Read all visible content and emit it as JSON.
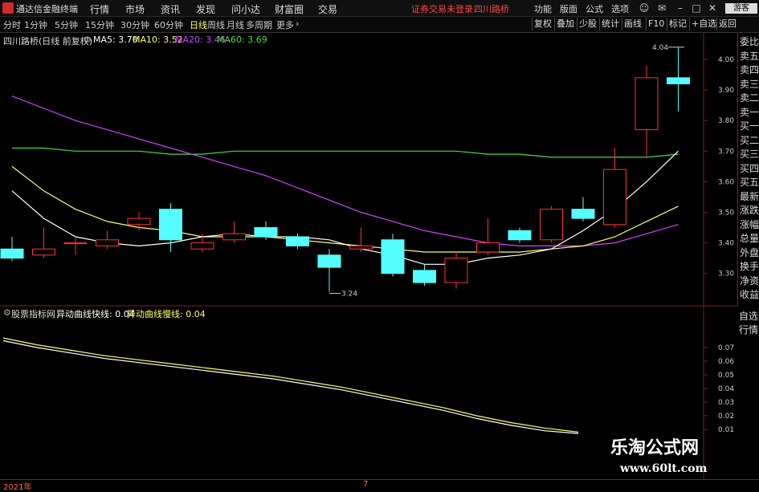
{
  "titlebar": {
    "app_name": "通达信金融终端",
    "menus": [
      "行情",
      "市场",
      "资讯",
      "发现",
      "问小达",
      "财富圈",
      "交易"
    ],
    "status": "证券交易未登录",
    "stock": "四川路桥",
    "right_menus": [
      "功能",
      "版面",
      "公式",
      "选项"
    ],
    "guest": "游客"
  },
  "toolbar": {
    "periods": [
      "分时",
      "1分钟",
      "5分钟",
      "15分钟",
      "30分钟",
      "60分钟",
      "日线",
      "周线",
      "月线",
      "多周期",
      "更多"
    ],
    "active_period": "日线",
    "buttons": [
      "复权",
      "叠加",
      "少股",
      "统计",
      "画线",
      "F10",
      "标记",
      "+自选",
      "返回"
    ]
  },
  "info": {
    "stock_label": "四川路桥(日线 前复权)",
    "ma5": "MA5: 3.70",
    "ma10": "MA10: 3.52",
    "ma20": "MA20: 3.46",
    "ma60": "MA60: 3.69"
  },
  "colors": {
    "up": "#ff3333",
    "down": "#55ffff",
    "ma5": "#ffffff",
    "ma10": "#ffff66",
    "ma20": "#cc44ff",
    "ma60": "#44dd44",
    "axis_red": "#8b1a1a"
  },
  "price_axis": [
    "4.00",
    "3.90",
    "3.80",
    "3.70",
    "3.60",
    "3.50",
    "3.40",
    "3.30"
  ],
  "annotations": {
    "high": "4.04",
    "low": "3.24"
  },
  "candles": [
    {
      "o": 3.38,
      "c": 3.35,
      "h": 3.42,
      "l": 3.34
    },
    {
      "o": 3.36,
      "c": 3.38,
      "h": 3.45,
      "l": 3.35
    },
    {
      "o": 3.4,
      "c": 3.4,
      "h": 3.42,
      "l": 3.36
    },
    {
      "o": 3.39,
      "c": 3.41,
      "h": 3.44,
      "l": 3.38
    },
    {
      "o": 3.46,
      "c": 3.48,
      "h": 3.5,
      "l": 3.44
    },
    {
      "o": 3.51,
      "c": 3.41,
      "h": 3.53,
      "l": 3.37
    },
    {
      "o": 3.38,
      "c": 3.4,
      "h": 3.43,
      "l": 3.37
    },
    {
      "o": 3.41,
      "c": 3.43,
      "h": 3.47,
      "l": 3.4
    },
    {
      "o": 3.45,
      "c": 3.42,
      "h": 3.47,
      "l": 3.41
    },
    {
      "o": 3.42,
      "c": 3.39,
      "h": 3.43,
      "l": 3.38
    },
    {
      "o": 3.36,
      "c": 3.32,
      "h": 3.38,
      "l": 3.24
    },
    {
      "o": 3.38,
      "c": 3.39,
      "h": 3.45,
      "l": 3.37
    },
    {
      "o": 3.41,
      "c": 3.3,
      "h": 3.43,
      "l": 3.29
    },
    {
      "o": 3.31,
      "c": 3.27,
      "h": 3.33,
      "l": 3.26
    },
    {
      "o": 3.27,
      "c": 3.35,
      "h": 3.37,
      "l": 3.25
    },
    {
      "o": 3.37,
      "c": 3.4,
      "h": 3.48,
      "l": 3.36
    },
    {
      "o": 3.44,
      "c": 3.41,
      "h": 3.45,
      "l": 3.4
    },
    {
      "o": 3.41,
      "c": 3.51,
      "h": 3.52,
      "l": 3.4
    },
    {
      "o": 3.51,
      "c": 3.48,
      "h": 3.55,
      "l": 3.47
    },
    {
      "o": 3.46,
      "c": 3.64,
      "h": 3.71,
      "l": 3.45
    },
    {
      "o": 3.77,
      "c": 3.94,
      "h": 3.98,
      "l": 3.68
    },
    {
      "o": 3.94,
      "c": 3.92,
      "h": 4.04,
      "l": 3.83
    }
  ],
  "ma_lines": {
    "ma5": [
      3.57,
      3.48,
      3.42,
      3.4,
      3.39,
      3.4,
      3.42,
      3.43,
      3.42,
      3.42,
      3.41,
      3.38,
      3.36,
      3.33,
      3.33,
      3.35,
      3.36,
      3.38,
      3.44,
      3.51,
      3.6,
      3.7
    ],
    "ma10": [
      3.65,
      3.57,
      3.51,
      3.47,
      3.45,
      3.44,
      3.42,
      3.42,
      3.42,
      3.41,
      3.4,
      3.39,
      3.38,
      3.37,
      3.37,
      3.37,
      3.37,
      3.38,
      3.39,
      3.42,
      3.47,
      3.52
    ],
    "ma20": [
      3.88,
      3.84,
      3.8,
      3.77,
      3.74,
      3.71,
      3.68,
      3.65,
      3.62,
      3.58,
      3.54,
      3.5,
      3.47,
      3.44,
      3.42,
      3.4,
      3.39,
      3.39,
      3.39,
      3.4,
      3.43,
      3.46
    ],
    "ma60": [
      3.71,
      3.71,
      3.7,
      3.7,
      3.7,
      3.69,
      3.69,
      3.7,
      3.7,
      3.7,
      3.7,
      3.7,
      3.7,
      3.7,
      3.7,
      3.69,
      3.69,
      3.68,
      3.68,
      3.68,
      3.68,
      3.69
    ]
  },
  "indicator": {
    "name": "股票指标网",
    "fast_label": "异动曲线快线: 0.04",
    "slow_label": "异动曲线慢线: 0.04",
    "axis": [
      "0.07",
      "0.06",
      "0.05",
      "0.04",
      "0.03",
      "0.02",
      "0.01"
    ],
    "fast": [
      0.075,
      0.07,
      0.066,
      0.062,
      0.059,
      0.056,
      0.053,
      0.05,
      0.047,
      0.043,
      0.039,
      0.034,
      0.029,
      0.024,
      0.018,
      0.013,
      0.009,
      0.007
    ],
    "slow": [
      0.077,
      0.072,
      0.068,
      0.064,
      0.061,
      0.058,
      0.055,
      0.052,
      0.049,
      0.045,
      0.041,
      0.036,
      0.031,
      0.026,
      0.02,
      0.015,
      0.011,
      0.008
    ]
  },
  "side_panel": [
    "委比",
    "卖五",
    "卖四",
    "卖三",
    "卖二",
    "卖一",
    "买一",
    "买二",
    "买三",
    "买四",
    "买五",
    "最新",
    "涨跌",
    "涨幅",
    "总量",
    "外盘",
    "换手",
    "净资",
    "收益"
  ],
  "side_panel2": [
    "自选",
    "行情"
  ],
  "dates": {
    "year": "2021年",
    "month": "7"
  },
  "watermark": {
    "name": "乐淘公式网",
    "url": "www.60lt.com"
  }
}
